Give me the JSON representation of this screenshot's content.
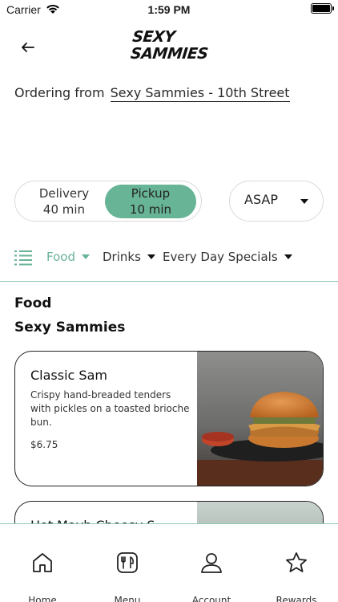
{
  "status_bar": {
    "carrier": "Carrier",
    "time": "1:59 PM"
  },
  "header": {
    "logo_line1": "SEXY",
    "logo_line2": "SAMMIES"
  },
  "ordering": {
    "prefix": "Ordering from",
    "store": "Sexy Sammies - 10th Street"
  },
  "fulfillment": {
    "delivery_label": "Delivery",
    "delivery_time": "40 min",
    "pickup_label": "Pickup",
    "pickup_time": "10 min",
    "selected": "pickup",
    "time_select": "ASAP"
  },
  "categories": {
    "items": [
      "Food",
      "Drinks",
      "Every Day Specials"
    ],
    "active": "Food"
  },
  "section": {
    "title": "Food",
    "subtitle": "Sexy Sammies"
  },
  "menu_items": [
    {
      "name": "Classic Sam",
      "description": "Crispy hand-breaded tenders with pickles on a toasted brioche bun.",
      "price": "$6.75"
    },
    {
      "name": "Hot Mayb Cheesy S"
    }
  ],
  "tab_bar": {
    "home": "Home",
    "menu": "Menu",
    "account": "Account",
    "rewards": "Rewards"
  },
  "colors": {
    "accent": "#68b497",
    "divider": "#8ec9b1"
  }
}
